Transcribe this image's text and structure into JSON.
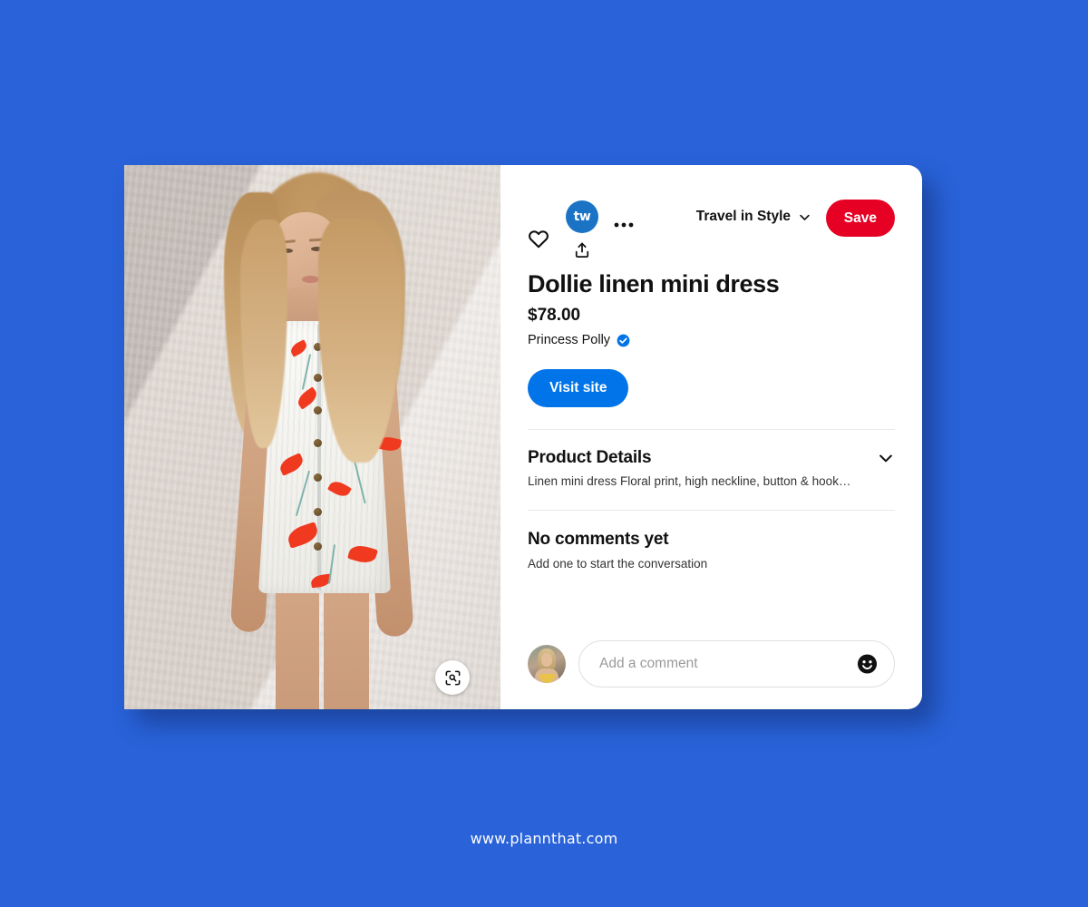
{
  "page": {
    "background_color": "#2962d9",
    "footer_url": "www.plannthat.com"
  },
  "pin": {
    "image_alt": "Woman in white floral print linen mini dress against a white wall",
    "visual_search_icon": "visual-search-icon",
    "actions": {
      "react_icon": "heart-icon",
      "more_icon": "more-options-icon",
      "share_icon": "share-icon",
      "creator_avatar_mark": "tw",
      "creator_avatar_color": "#1a73c4"
    },
    "board": {
      "name": "Travel in Style",
      "chevron_icon": "chevron-down-icon"
    },
    "save_label": "Save",
    "save_color": "#e60023",
    "title": "Dollie linen mini dress",
    "price": "$78.00",
    "merchant": {
      "name": "Princess Polly",
      "verified_icon": "verified-badge-icon",
      "verified_color": "#0074e8"
    },
    "visit_site_label": "Visit site",
    "visit_site_color": "#0074e8",
    "product_details": {
      "heading": "Product Details",
      "expand_icon": "chevron-down-icon",
      "text": "Linen mini dress  Floral print, high neckline, button & hook…"
    },
    "comments": {
      "empty_title": "No comments yet",
      "empty_subtitle": "Add one to start the conversation",
      "input_placeholder": "Add a comment",
      "input_value": "",
      "emoji_icon": "emoji-smiley-icon",
      "user_avatar": "user-avatar"
    }
  }
}
